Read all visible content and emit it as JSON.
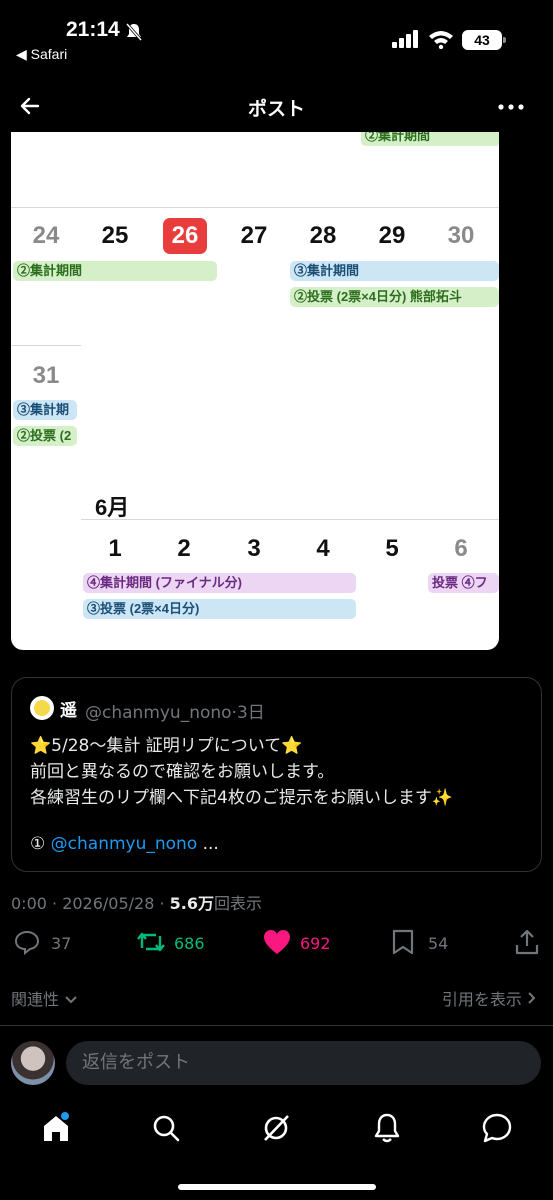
{
  "status_bar": {
    "time": "21:14",
    "back_app": "◀ Safari",
    "battery": "43"
  },
  "nav": {
    "title": "ポスト"
  },
  "calendar": {
    "top_event": "②集計期間",
    "week1": {
      "days": [
        "24",
        "25",
        "26",
        "27",
        "28",
        "29",
        "30"
      ],
      "today": "26"
    },
    "week1_events": {
      "e1": "②集計期間",
      "e2": "③集計期間",
      "e3": "②投票 (2票×4日分) 熊部拓斗"
    },
    "week2": {
      "day": "31",
      "e1": "③集計期",
      "e2": "②投票 (2"
    },
    "month": "6月",
    "week3": {
      "days": [
        "1",
        "2",
        "3",
        "4",
        "5",
        "6"
      ]
    },
    "week3_events": {
      "e1": "④集計期間 (ファイナル分)",
      "e2": "③投票 (2票×4日分)",
      "e3": "投票 ④フ"
    }
  },
  "quote": {
    "name": "遥",
    "handle": "@chanmyu_nono·3日",
    "line1": "⭐5/28〜集計 証明リプについて⭐",
    "line2": "前回と異なるので確認をお願いします。",
    "line3": "各練習生のリプ欄へ下記4枚のご提示をお願いします✨",
    "line4_prefix": "① ",
    "line4_link": "@chanmyu_nono",
    "line4_suffix": " ..."
  },
  "meta": {
    "prefix": "0:00 · 2026/05/28 · ",
    "views": "5.6万",
    "views_label": "回表示"
  },
  "actions": {
    "replies": "37",
    "reposts": "686",
    "likes": "692",
    "bookmarks": "54"
  },
  "sort_label": "関連性",
  "quotes_label": "引用を表示",
  "reply_placeholder": "返信をポスト",
  "colors": {
    "repost": "#00ba7c",
    "like": "#f91880",
    "link": "#1d9bf0",
    "today": "#e93c3c"
  }
}
